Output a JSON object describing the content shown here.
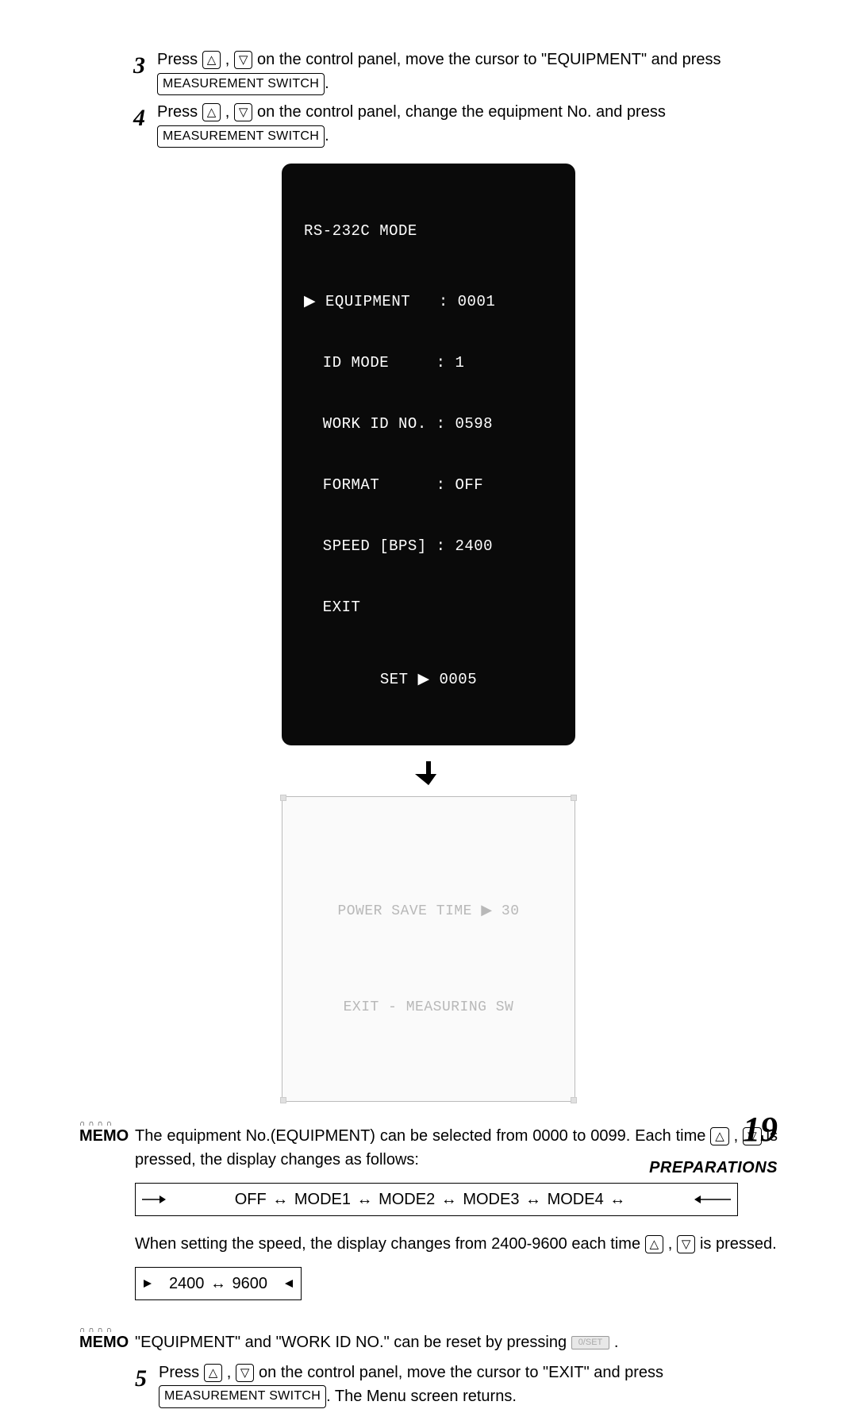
{
  "step3": {
    "num": "3",
    "line": "Press ",
    "sep": " , ",
    "after": " on the control panel, move the cursor to \"EQUIPMENT\" and press ",
    "btn": "MEASUREMENT SWITCH",
    "period": "."
  },
  "step4": {
    "num": "4",
    "line": "Press ",
    "sep": " , ",
    "after": " on the control panel, change the equipment No. and press ",
    "btn": "MEASUREMENT SWITCH",
    "period": "."
  },
  "dark": {
    "title": "RS-232C MODE",
    "r1a": "▶ EQUIPMENT   :",
    "r1b": "0001",
    "r2a": "  ID MODE     :",
    "r2b": "1",
    "r3a": "  WORK ID NO. :",
    "r3b": "0598",
    "r4a": "  FORMAT      :",
    "r4b": "OFF",
    "r5a": "  SPEED [BPS] :",
    "r5b": "2400",
    "r6": "  EXIT",
    "set": "SET ▶ 0005"
  },
  "light": {
    "l1": "POWER SAVE TIME ▶ 30",
    "l2": "EXIT - MEASURING SW"
  },
  "memo1": {
    "label": "MEMO",
    "text1": "The equipment No.(EQUIPMENT) can be selected from 0000 to 0099.  Each time ",
    "sep": " , ",
    "text2": " is pressed, the display changes as follows:",
    "flow": "OFF ↔ MODE1 ↔ MODE2 ↔ MODE3 ↔ MODE4 ↔",
    "speed1": "When setting the speed, the display changes from 2400-9600 each time ",
    "speed2": " is pressed.",
    "flow2": "2400 ↔ 9600"
  },
  "memo2": {
    "label": "MEMO",
    "text": "\"EQUIPMENT\" and \"WORK ID NO.\" can be reset by pressing ",
    "period": " ."
  },
  "step5": {
    "num": "5",
    "line": "Press ",
    "sep": " , ",
    "after": " on the control panel, move the cursor to \"EXIT\" and press ",
    "btn": "MEASUREMENT SWITCH",
    "tail": ".  The Menu screen returns."
  },
  "icons": {
    "up": "△",
    "down": "▽",
    "flat": "0/SET"
  },
  "footer": {
    "num": "19",
    "sec": "PREPARATIONS"
  }
}
